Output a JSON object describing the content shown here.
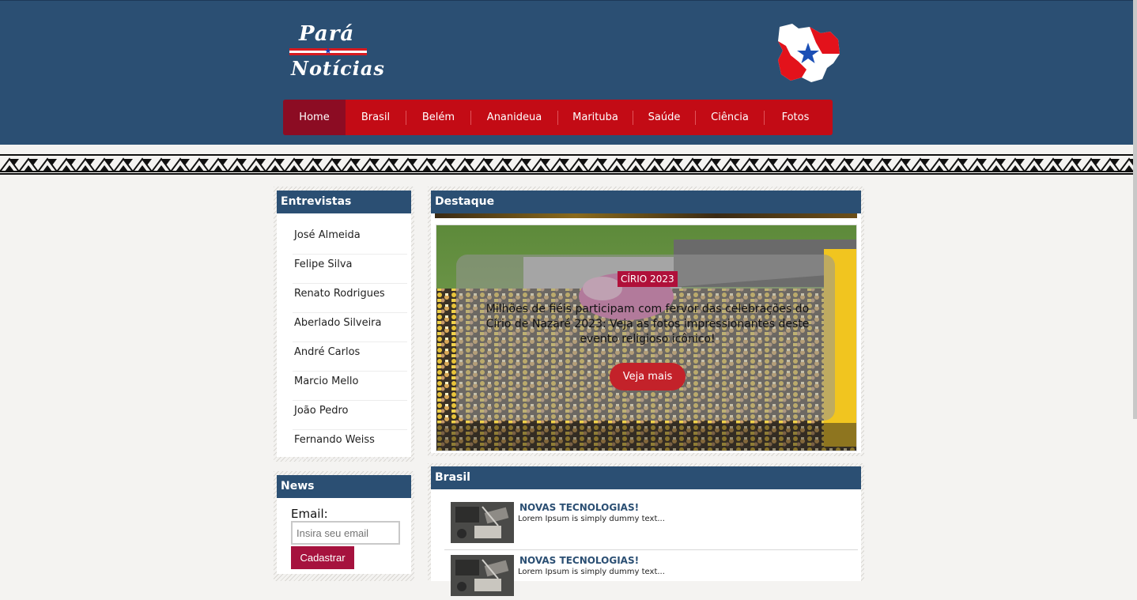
{
  "brand": {
    "line1": "Pará",
    "line2": "Notícias"
  },
  "nav": {
    "items": [
      {
        "label": "Home"
      },
      {
        "label": "Brasil"
      },
      {
        "label": "Belém"
      },
      {
        "label": "Ananideua"
      },
      {
        "label": "Marituba"
      },
      {
        "label": "Saúde"
      },
      {
        "label": "Ciência"
      },
      {
        "label": "Fotos"
      }
    ],
    "active": "Home"
  },
  "entrevistas": {
    "title": "Entrevistas",
    "items": [
      "José Almeida",
      "Felipe Silva",
      "Renato Rodrigues",
      "Aberlado Silveira",
      "André Carlos",
      "Marcio Mello",
      "João Pedro",
      "Fernando Weiss"
    ]
  },
  "newsletter": {
    "title": "News",
    "email_label": "Email:",
    "email_placeholder": "Insira seu email",
    "submit_label": "Cadastrar"
  },
  "destaque": {
    "title": "Destaque",
    "tag": "CÍRIO 2023",
    "headline": "Milhões de fiéis participam com fervor das celebrações do Círio de Nazaré 2023: Veja as fotos impressionantes deste evento religioso icônico!",
    "cta": "Veja mais"
  },
  "brasil": {
    "title": "Brasil",
    "items": [
      {
        "title": "NOVAS TECNOLOGIAS!",
        "summary": "Lorem Ipsum is simply dummy text..."
      },
      {
        "title": "NOVAS TECNOLOGIAS!",
        "summary": "Lorem Ipsum is simply dummy text..."
      }
    ]
  },
  "colors": {
    "header_bg": "#2b4f73",
    "nav_bg": "#c30b15",
    "nav_active": "#8c0c23",
    "accent": "#a6123e",
    "page_bg": "#f4f3f1"
  }
}
